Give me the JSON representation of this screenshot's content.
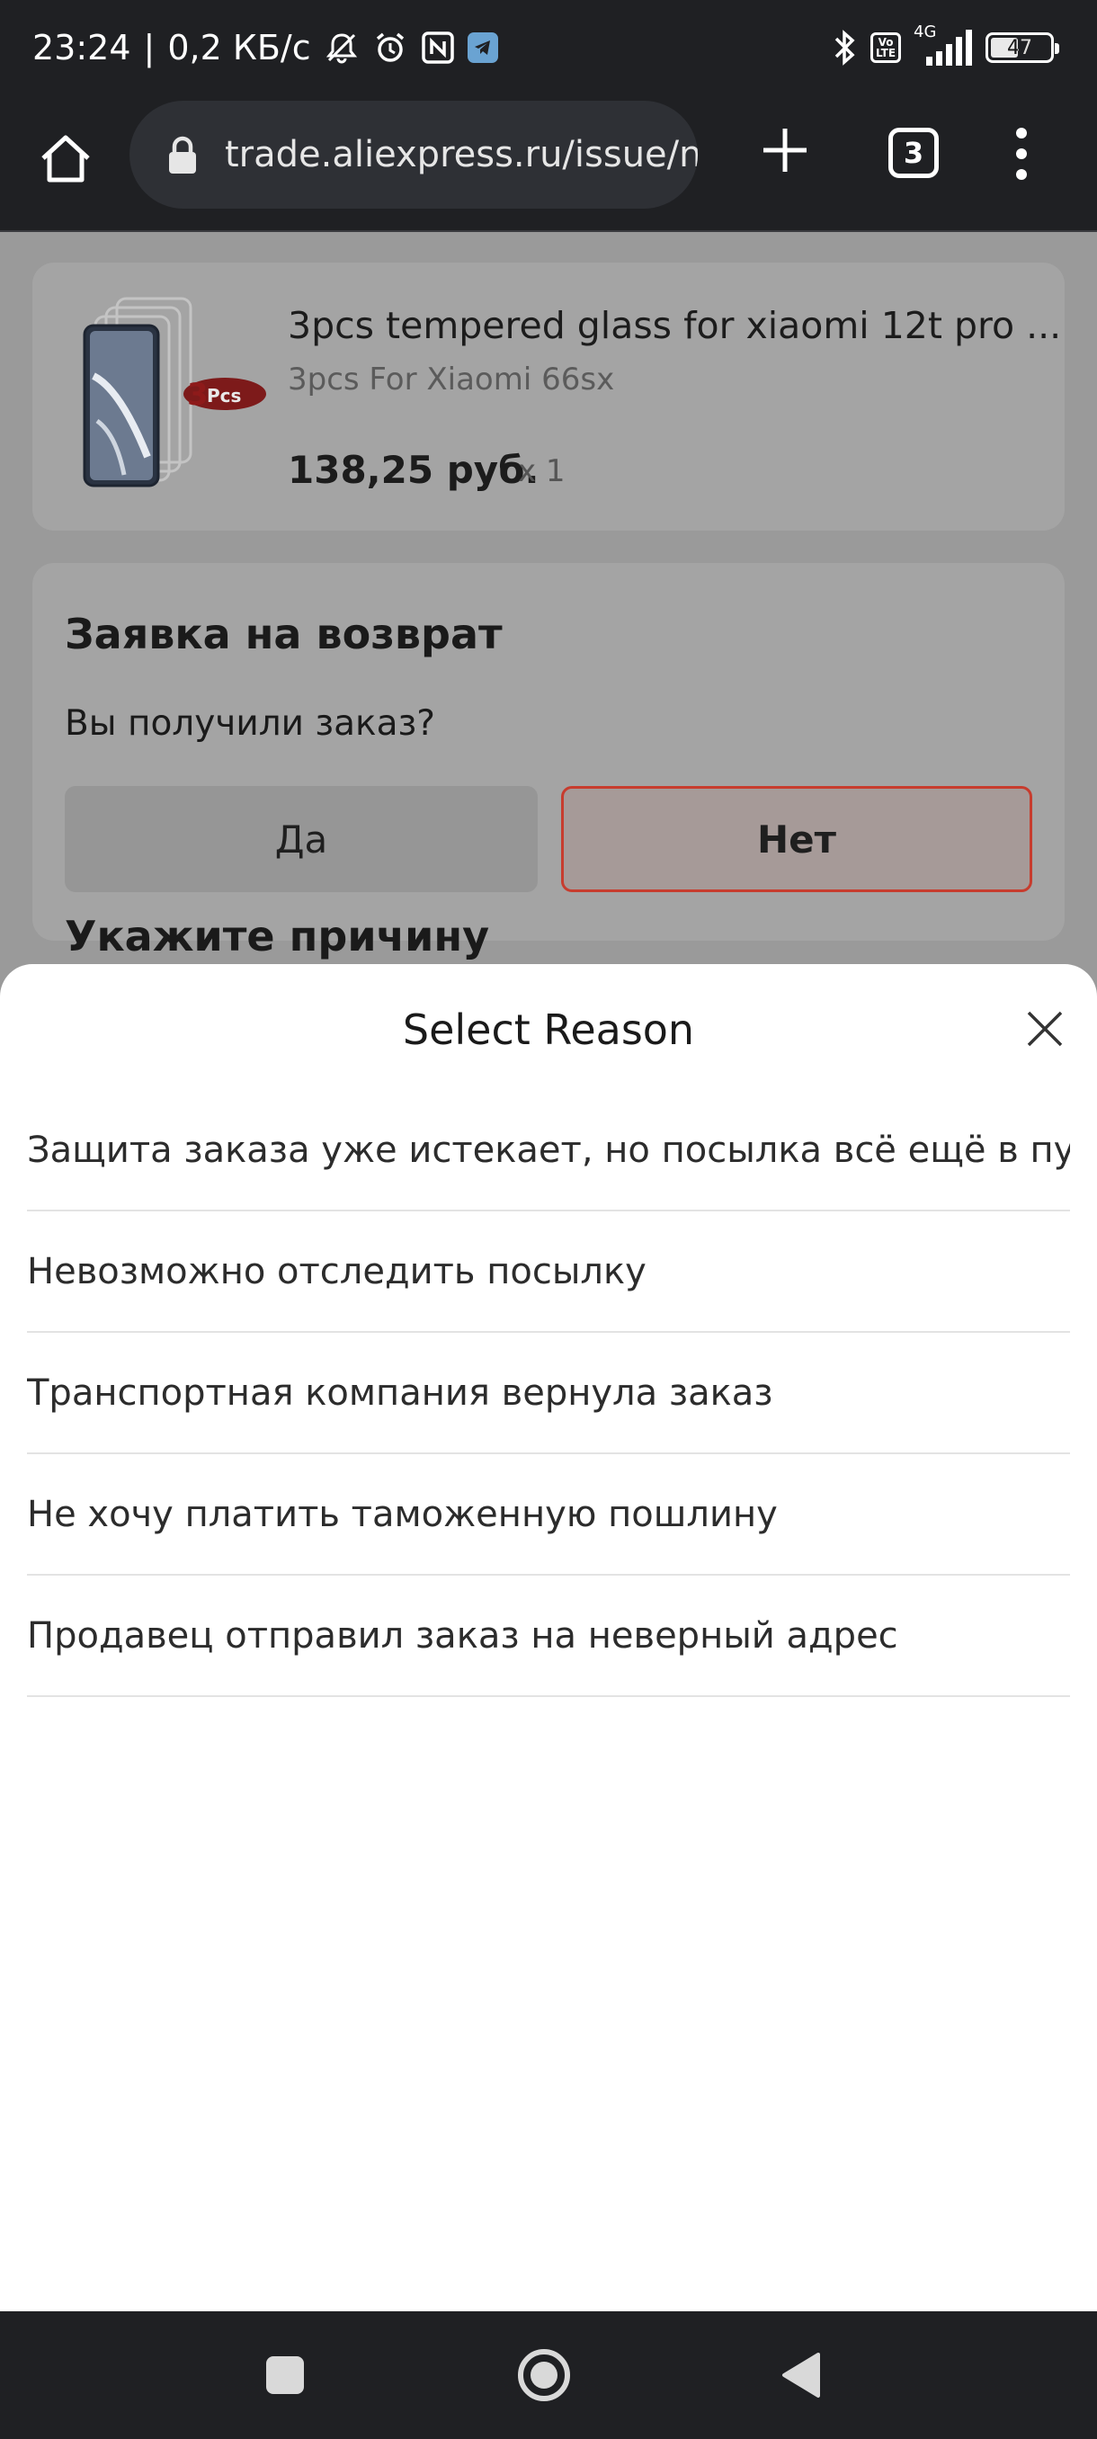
{
  "status_bar": {
    "time": "23:24",
    "separator": "|",
    "speed": "0,2 КБ/с",
    "network": "4G",
    "volte_top": "Vo",
    "volte_bottom": "LTE",
    "battery": "47"
  },
  "browser": {
    "url": "trade.aliexpress.ru/issue/new",
    "tab_count": "3"
  },
  "product": {
    "title": "3pcs tempered glass for xiaomi 12t pro ...",
    "variant": "3pcs For Xiaomi 66sx",
    "price": "138,25 руб.",
    "quantity": "x 1",
    "badge": "3Pcs"
  },
  "return_request": {
    "title": "Заявка на возврат",
    "question": "Вы получили заказ?",
    "yes_label": "Да",
    "no_label": "Нет",
    "reason_heading": "Укажите причину"
  },
  "sheet": {
    "title": "Select Reason",
    "reasons": [
      "Защита заказа уже истекает, но посылка всё ещё в пути",
      "Невозможно отследить посылку",
      "Транспортная компания вернула заказ",
      "Не хочу платить таможенную пошлину",
      "Продавец отправил заказ на неверный адрес"
    ]
  },
  "colors": {
    "accent_border": "#c73c2e",
    "chrome_bg": "#1f2023"
  }
}
